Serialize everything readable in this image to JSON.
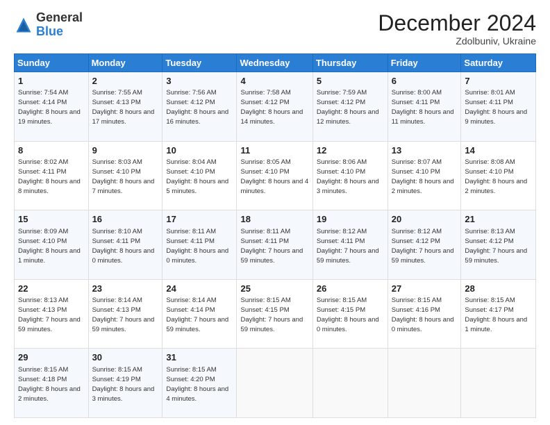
{
  "header": {
    "logo": {
      "general": "General",
      "blue": "Blue"
    },
    "title": "December 2024",
    "subtitle": "Zdolbuniv, Ukraine"
  },
  "days_of_week": [
    "Sunday",
    "Monday",
    "Tuesday",
    "Wednesday",
    "Thursday",
    "Friday",
    "Saturday"
  ],
  "weeks": [
    [
      {
        "day": "1",
        "sunrise": "7:54 AM",
        "sunset": "4:14 PM",
        "daylight": "8 hours and 19 minutes."
      },
      {
        "day": "2",
        "sunrise": "7:55 AM",
        "sunset": "4:13 PM",
        "daylight": "8 hours and 17 minutes."
      },
      {
        "day": "3",
        "sunrise": "7:56 AM",
        "sunset": "4:12 PM",
        "daylight": "8 hours and 16 minutes."
      },
      {
        "day": "4",
        "sunrise": "7:58 AM",
        "sunset": "4:12 PM",
        "daylight": "8 hours and 14 minutes."
      },
      {
        "day": "5",
        "sunrise": "7:59 AM",
        "sunset": "4:12 PM",
        "daylight": "8 hours and 12 minutes."
      },
      {
        "day": "6",
        "sunrise": "8:00 AM",
        "sunset": "4:11 PM",
        "daylight": "8 hours and 11 minutes."
      },
      {
        "day": "7",
        "sunrise": "8:01 AM",
        "sunset": "4:11 PM",
        "daylight": "8 hours and 9 minutes."
      }
    ],
    [
      {
        "day": "8",
        "sunrise": "8:02 AM",
        "sunset": "4:11 PM",
        "daylight": "8 hours and 8 minutes."
      },
      {
        "day": "9",
        "sunrise": "8:03 AM",
        "sunset": "4:10 PM",
        "daylight": "8 hours and 7 minutes."
      },
      {
        "day": "10",
        "sunrise": "8:04 AM",
        "sunset": "4:10 PM",
        "daylight": "8 hours and 5 minutes."
      },
      {
        "day": "11",
        "sunrise": "8:05 AM",
        "sunset": "4:10 PM",
        "daylight": "8 hours and 4 minutes."
      },
      {
        "day": "12",
        "sunrise": "8:06 AM",
        "sunset": "4:10 PM",
        "daylight": "8 hours and 3 minutes."
      },
      {
        "day": "13",
        "sunrise": "8:07 AM",
        "sunset": "4:10 PM",
        "daylight": "8 hours and 2 minutes."
      },
      {
        "day": "14",
        "sunrise": "8:08 AM",
        "sunset": "4:10 PM",
        "daylight": "8 hours and 2 minutes."
      }
    ],
    [
      {
        "day": "15",
        "sunrise": "8:09 AM",
        "sunset": "4:10 PM",
        "daylight": "8 hours and 1 minute."
      },
      {
        "day": "16",
        "sunrise": "8:10 AM",
        "sunset": "4:11 PM",
        "daylight": "8 hours and 0 minutes."
      },
      {
        "day": "17",
        "sunrise": "8:11 AM",
        "sunset": "4:11 PM",
        "daylight": "8 hours and 0 minutes."
      },
      {
        "day": "18",
        "sunrise": "8:11 AM",
        "sunset": "4:11 PM",
        "daylight": "7 hours and 59 minutes."
      },
      {
        "day": "19",
        "sunrise": "8:12 AM",
        "sunset": "4:11 PM",
        "daylight": "7 hours and 59 minutes."
      },
      {
        "day": "20",
        "sunrise": "8:12 AM",
        "sunset": "4:12 PM",
        "daylight": "7 hours and 59 minutes."
      },
      {
        "day": "21",
        "sunrise": "8:13 AM",
        "sunset": "4:12 PM",
        "daylight": "7 hours and 59 minutes."
      }
    ],
    [
      {
        "day": "22",
        "sunrise": "8:13 AM",
        "sunset": "4:13 PM",
        "daylight": "7 hours and 59 minutes."
      },
      {
        "day": "23",
        "sunrise": "8:14 AM",
        "sunset": "4:13 PM",
        "daylight": "7 hours and 59 minutes."
      },
      {
        "day": "24",
        "sunrise": "8:14 AM",
        "sunset": "4:14 PM",
        "daylight": "7 hours and 59 minutes."
      },
      {
        "day": "25",
        "sunrise": "8:15 AM",
        "sunset": "4:15 PM",
        "daylight": "7 hours and 59 minutes."
      },
      {
        "day": "26",
        "sunrise": "8:15 AM",
        "sunset": "4:15 PM",
        "daylight": "8 hours and 0 minutes."
      },
      {
        "day": "27",
        "sunrise": "8:15 AM",
        "sunset": "4:16 PM",
        "daylight": "8 hours and 0 minutes."
      },
      {
        "day": "28",
        "sunrise": "8:15 AM",
        "sunset": "4:17 PM",
        "daylight": "8 hours and 1 minute."
      }
    ],
    [
      {
        "day": "29",
        "sunrise": "8:15 AM",
        "sunset": "4:18 PM",
        "daylight": "8 hours and 2 minutes."
      },
      {
        "day": "30",
        "sunrise": "8:15 AM",
        "sunset": "4:19 PM",
        "daylight": "8 hours and 3 minutes."
      },
      {
        "day": "31",
        "sunrise": "8:15 AM",
        "sunset": "4:20 PM",
        "daylight": "8 hours and 4 minutes."
      },
      null,
      null,
      null,
      null
    ]
  ]
}
